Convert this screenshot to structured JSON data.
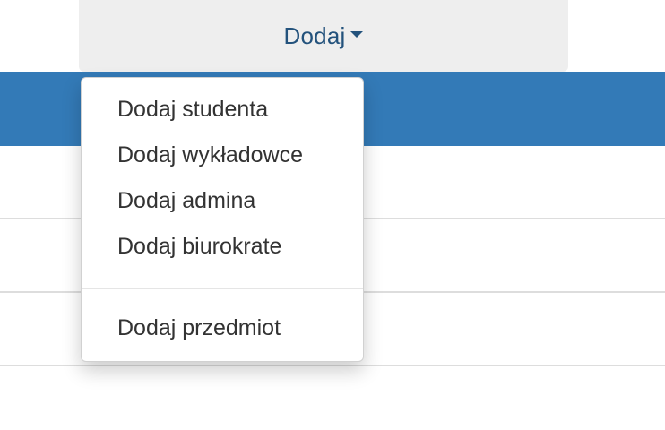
{
  "nav": {
    "dropdown_toggle_label": "Dodaj"
  },
  "dropdown": {
    "items": [
      {
        "label": "Dodaj studenta"
      },
      {
        "label": "Dodaj wykładowce"
      },
      {
        "label": "Dodaj admina"
      },
      {
        "label": "Dodaj biurokrate"
      }
    ],
    "extra_items": [
      {
        "label": "Dodaj przedmiot"
      }
    ]
  },
  "colors": {
    "header_band": "#337ab7",
    "toggle_text": "#23527c",
    "tab_background": "#eeeeee",
    "menu_text": "#333333"
  },
  "icons": {
    "toggle": "caret-down-icon"
  }
}
